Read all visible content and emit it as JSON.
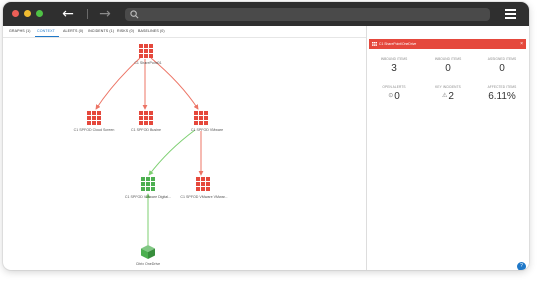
{
  "window": {
    "controls": [
      "close",
      "minimize",
      "maximize"
    ],
    "nav": {
      "back_icon": "arrow-left-icon",
      "forward_icon": "arrow-right-icon"
    },
    "address_bar": {
      "value": "",
      "icon": "search-icon"
    },
    "menu_icon": "hamburger-menu-icon"
  },
  "tabs": [
    {
      "label": "GRAPHS (1)",
      "active": false
    },
    {
      "label": "CONTEXT",
      "active": true
    },
    {
      "label": "ALERTS (0)",
      "active": false
    },
    {
      "label": "INCIDENTS (1)",
      "active": false
    },
    {
      "label": "RISKS (0)",
      "active": false
    },
    {
      "label": "BASELINES (0)",
      "active": false
    }
  ],
  "graph": {
    "nodes": [
      {
        "id": "root",
        "label": "C1 SharePoint01",
        "color": "#e5483c",
        "kind": "grid"
      },
      {
        "id": "cloud",
        "label": "C1 SPFOD Cloud Screen",
        "color": "#e5483c",
        "kind": "grid"
      },
      {
        "id": "busine",
        "label": "C1 SPFOD Busine",
        "color": "#e5483c",
        "kind": "grid"
      },
      {
        "id": "vmware",
        "label": "C1 SPFOD VMware",
        "color": "#e5483c",
        "kind": "grid"
      },
      {
        "id": "digital",
        "label": "C1 SPFOD VMware Digital...",
        "color": "#4caf50",
        "kind": "grid"
      },
      {
        "id": "vmware2",
        "label": "C1 SPFOD VMware VMwar...",
        "color": "#e5483c",
        "kind": "grid"
      },
      {
        "id": "onedrive",
        "label": "Citrix OneDrive",
        "color": "#4caf50",
        "kind": "cube"
      }
    ],
    "edge_colors": {
      "red": "#ec7465",
      "green": "#7ccf70"
    }
  },
  "panel": {
    "header_title": "C1 SharePoint/OneDrive",
    "header_icon": "grid-icon",
    "close_icon": "close-icon",
    "stats_row1": [
      {
        "label": "INBOUND ITEMS",
        "value": "3"
      },
      {
        "label": "INBOUND ITEMS",
        "value": "0"
      },
      {
        "label": "ASSIGNED ITEMS",
        "value": "0"
      }
    ],
    "stats_row2": [
      {
        "label": "OPEN ALERTS",
        "symbol": "⊙",
        "value": "0"
      },
      {
        "label": "KEY INCIDENTS",
        "symbol": "⚠",
        "value": "2"
      },
      {
        "label": "AFFECTED ITEMS",
        "symbol": "",
        "value": "6.11%"
      }
    ]
  },
  "help_button": {
    "label": "?",
    "icon": "help-icon"
  }
}
